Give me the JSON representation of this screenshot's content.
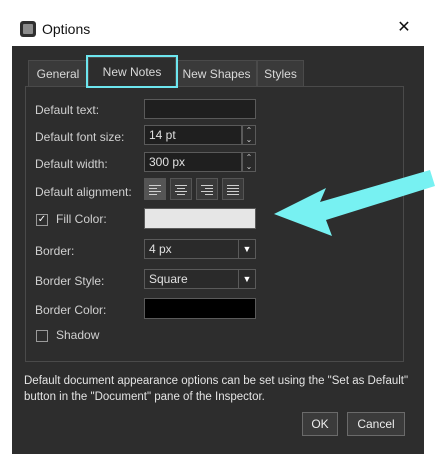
{
  "window": {
    "title": "Options",
    "close_glyph": "✕",
    "icon": "app-options-icon"
  },
  "tabs": [
    {
      "label": "General"
    },
    {
      "label": "New Notes",
      "selected": true
    },
    {
      "label": "New Shapes"
    },
    {
      "label": "Styles"
    }
  ],
  "form": {
    "default_text": {
      "label": "Default text:",
      "value": ""
    },
    "default_font_size": {
      "label": "Default font size:",
      "value": "14 pt"
    },
    "default_width": {
      "label": "Default width:",
      "value": "300 px"
    },
    "default_alignment": {
      "label": "Default alignment:",
      "options": [
        "left",
        "center",
        "right",
        "justify"
      ],
      "selected": "left"
    },
    "fill_color": {
      "label": "Fill Color:",
      "checked": true,
      "color": "#e6e6e6"
    },
    "border": {
      "label": "Border:",
      "value": "4 px"
    },
    "border_style": {
      "label": "Border Style:",
      "value": "Square"
    },
    "border_color": {
      "label": "Border Color:",
      "color": "#000000"
    },
    "shadow": {
      "label": "Shadow",
      "checked": false
    }
  },
  "info": "Default document appearance options can be set using the \"Set as Default\" button in the \"Document\" pane of the Inspector.",
  "buttons": {
    "ok": "OK",
    "cancel": "Cancel"
  },
  "colors": {
    "accent_highlight": "#6de6ef",
    "dialog_bg": "#2d2d2d"
  }
}
